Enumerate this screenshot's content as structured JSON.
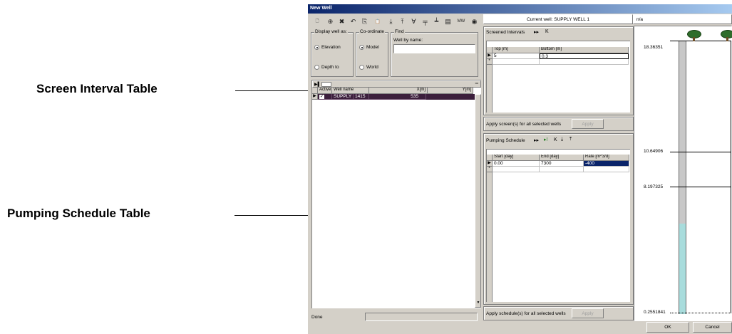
{
  "callouts": {
    "screen_interval": "Screen Interval Table",
    "pumping_schedule": "Pumping Schedule Table"
  },
  "window": {
    "title": "New Well",
    "current_well": "Current well: SUPPLY WELL 1",
    "na": "n/a",
    "status": "Done"
  },
  "toolbar": {
    "icons": [
      "new-icon",
      "add-well-icon",
      "delete-icon",
      "undo-icon",
      "copy-icon",
      "paste-icon",
      "import-icon",
      "export-icon",
      "filter-icon",
      "screen-icon",
      "pump-icon",
      "table-icon",
      "mw-icon",
      "help-icon"
    ],
    "glyphs": [
      "🗋",
      "⊕",
      "✖",
      "↶",
      "⎘",
      "📋",
      "⤓",
      "⤒",
      "∀",
      "╤",
      "┷",
      "▤",
      "MW",
      "◉"
    ]
  },
  "display": {
    "legend": "Display well as:",
    "elevation": "Elevation",
    "depth": "Depth to"
  },
  "coordinate": {
    "legend": "Co-ordinate",
    "model": "Model",
    "world": "World"
  },
  "find": {
    "legend": "Find",
    "label": "Well by name:",
    "value": ""
  },
  "well_table": {
    "columns": [
      "Active",
      "Well name",
      "X[m]",
      "Y[m]"
    ],
    "rows": [
      {
        "active": "✓",
        "name": "SUPPLY WE",
        "x": "1415",
        "y": "535"
      }
    ]
  },
  "screens": {
    "title": "Screened Intervals",
    "columns": [
      "Top [m]",
      "Bottom [m]"
    ],
    "rows": [
      {
        "top": "5",
        "bottom": "0.3"
      }
    ],
    "apply_label": "Apply screen(s) for all selected wells",
    "apply_button": "Apply"
  },
  "pumping": {
    "title": "Pumping Schedule",
    "columns": [
      "Start [day]",
      "End [day]",
      "Rate [m^3/d]"
    ],
    "rows": [
      {
        "start": "0.00",
        "end": "7300",
        "rate": "-400"
      }
    ],
    "apply_label": "Apply schedule(s) for all selected wells",
    "apply_button": "Apply"
  },
  "profile": {
    "labels": [
      "18.36351",
      "10.64906",
      "8.197325",
      "0.2551841"
    ],
    "water_level_fraction": 0.33
  },
  "buttons": {
    "ok": "OK",
    "cancel": "Cancel"
  }
}
